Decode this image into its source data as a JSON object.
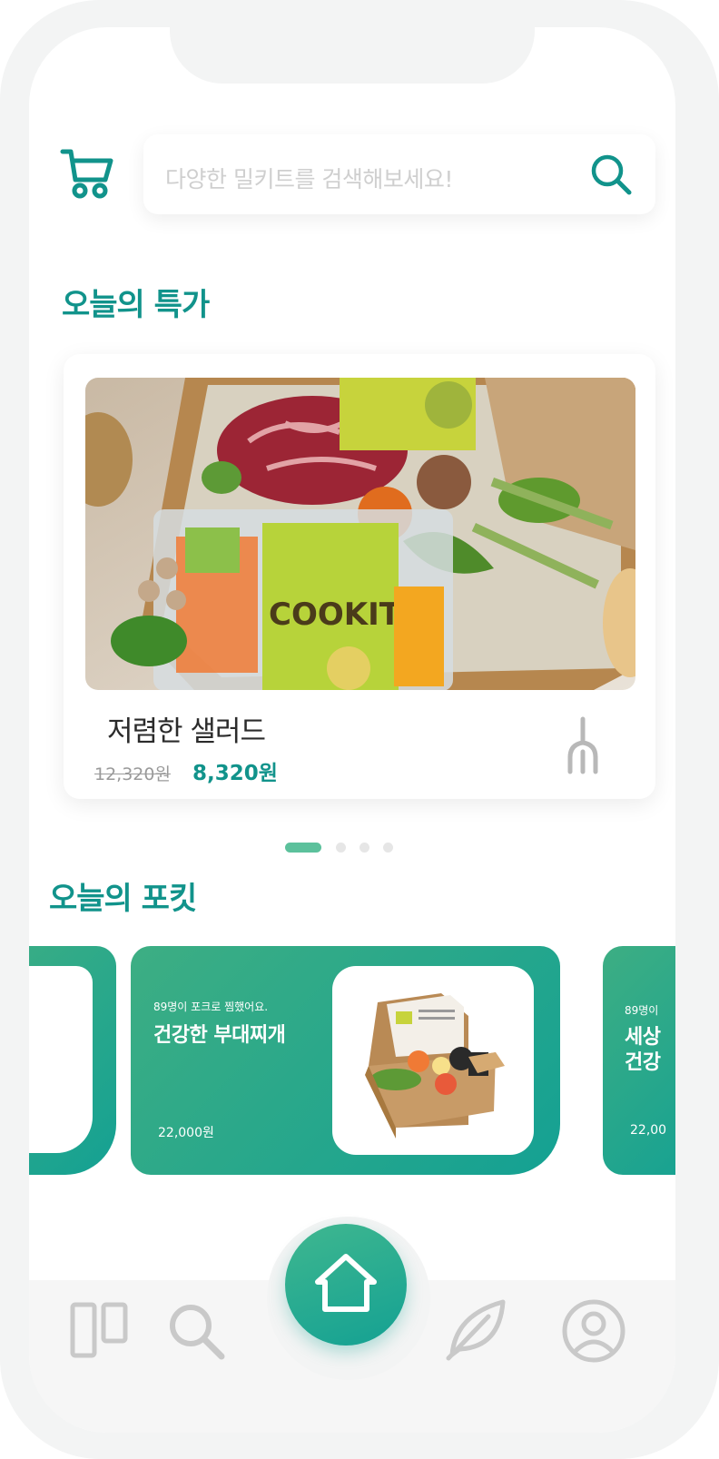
{
  "search": {
    "placeholder": "다양한 밀키트를 검색해보세요!"
  },
  "sections": {
    "deals_title": "오늘의 특가",
    "pokit_title": "오늘의 포킷"
  },
  "deal": {
    "name": "저렴한 샐러드",
    "old_price": "12,320원",
    "new_price": "8,320원",
    "image": {
      "box_brand_text": "COOKIT"
    }
  },
  "carousel": {
    "pages": 4,
    "active_index": 0
  },
  "pokit_cards": [
    {
      "count_text": "89명이 포크로 찜했어요.",
      "name": "건강한 부대찌개",
      "price": "22,000원"
    },
    {
      "count_text": "89명이",
      "name_line1": "세상",
      "name_line2": "건강",
      "price": "22,00"
    }
  ],
  "nav": {
    "items": [
      "grid-icon",
      "search-icon",
      "home-icon",
      "leaf-icon",
      "profile-icon"
    ],
    "active": "home-icon"
  },
  "colors": {
    "brand": "#11938b",
    "accent_green": "#3dae83",
    "icon_gray": "#c9c9c9"
  }
}
